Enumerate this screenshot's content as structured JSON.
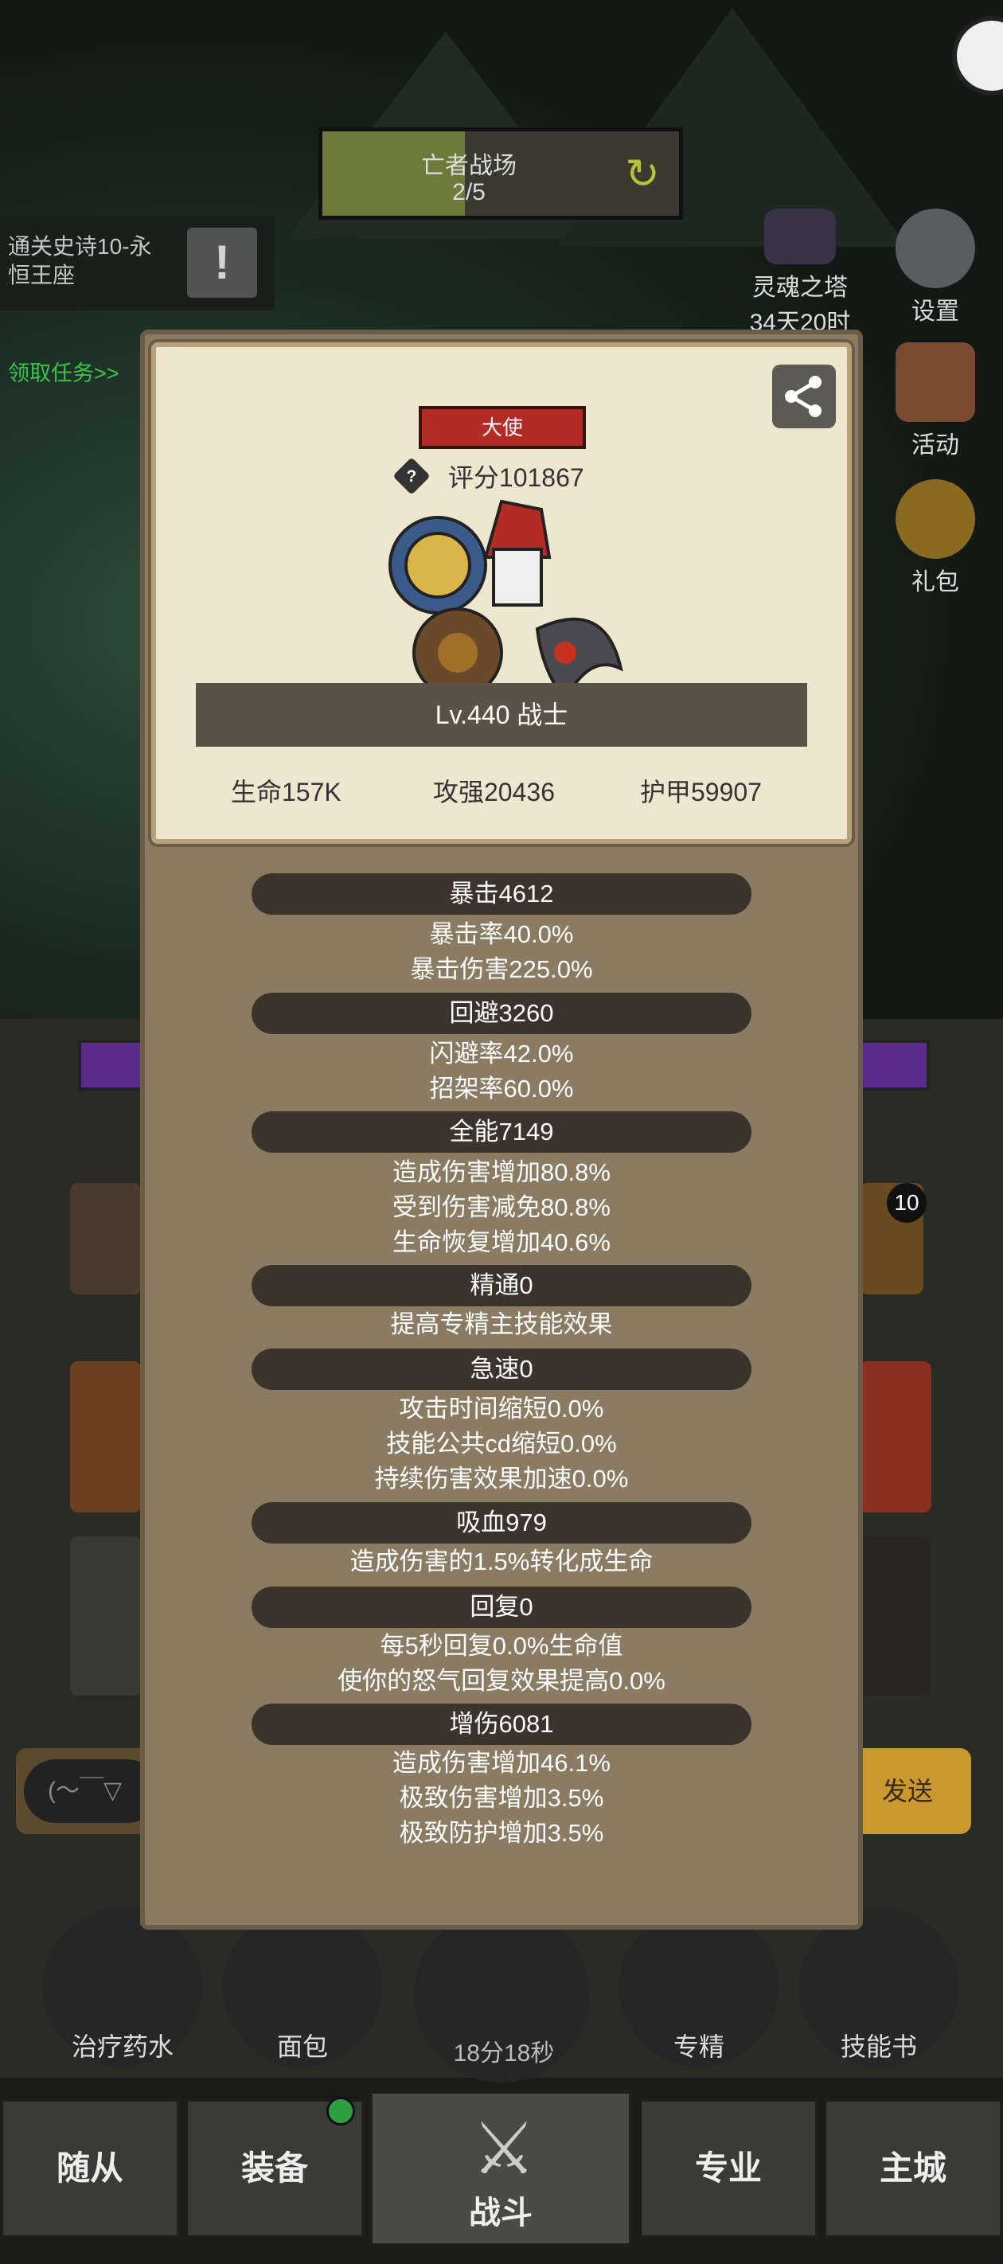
{
  "quest": {
    "title": "亡者战场",
    "progress": "2/5"
  },
  "mission": {
    "text": "通关史诗10-永恒王座",
    "claim_link": "领取任务>>"
  },
  "side_menu": {
    "tower": "灵魂之塔",
    "tower_timer": "34天20时",
    "settings": "设置",
    "activities": "活动",
    "gift": "礼包"
  },
  "chat": {
    "input_placeholder": "(～￣▽",
    "send": "发送"
  },
  "slot_badge": "10",
  "consumables": [
    {
      "label": "治疗药水"
    },
    {
      "label": "面包"
    },
    {
      "label": ""
    },
    {
      "label": "专精"
    },
    {
      "label": "技能书"
    }
  ],
  "chest_timer": "18分18秒",
  "tabs": [
    "随从",
    "装备",
    "战斗",
    "专业",
    "主城"
  ],
  "card": {
    "title": "大使",
    "score": "评分101867",
    "level": "Lv.440 战士",
    "hp": "生命157K",
    "attack": "攻强20436",
    "armor": "护甲59907"
  },
  "sections": [
    {
      "title": "暴击4612",
      "lines": [
        "暴击率40.0%",
        "暴击伤害225.0%"
      ]
    },
    {
      "title": "回避3260",
      "lines": [
        "闪避率42.0%",
        "招架率60.0%"
      ]
    },
    {
      "title": "全能7149",
      "lines": [
        "造成伤害增加80.8%",
        "受到伤害减免80.8%",
        "生命恢复增加40.6%"
      ]
    },
    {
      "title": "精通0",
      "lines": [
        "提高专精主技能效果"
      ]
    },
    {
      "title": "急速0",
      "lines": [
        "攻击时间缩短0.0%",
        "技能公共cd缩短0.0%",
        "持续伤害效果加速0.0%"
      ]
    },
    {
      "title": "吸血979",
      "lines": [
        "造成伤害的1.5%转化成生命"
      ]
    },
    {
      "title": "回复0",
      "lines": [
        "每5秒回复0.0%生命值",
        "使你的怒气回复效果提高0.0%"
      ]
    },
    {
      "title": "增伤6081",
      "lines": [
        "造成伤害增加46.1%",
        "极致伤害增加3.5%",
        "极致防护增加3.5%"
      ]
    }
  ],
  "colors": {
    "accent_red": "#b42a24",
    "panel": "#8a7b62",
    "card": "#efe6cf",
    "claim_green": "#36c64a"
  }
}
